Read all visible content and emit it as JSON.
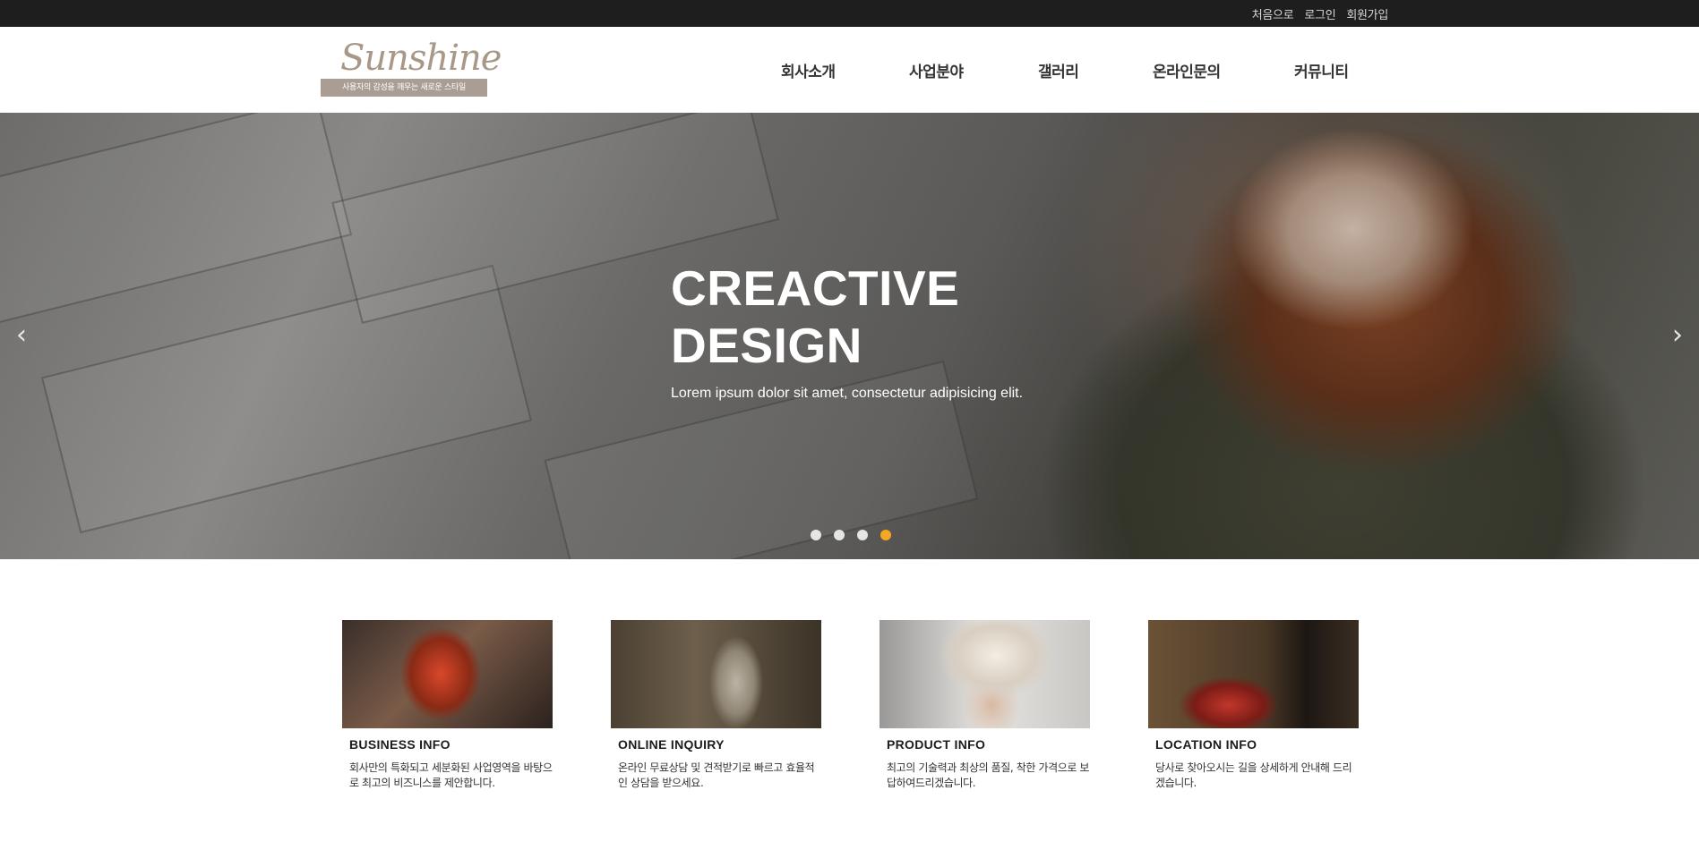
{
  "topbar": {
    "links": [
      "처음으로",
      "로그인",
      "회원가입"
    ]
  },
  "header": {
    "logo_text": "Sunshine",
    "logo_tagline": "사용자의 감성을 깨우는 새로운 스타일",
    "nav": [
      "회사소개",
      "사업분야",
      "갤러리",
      "온라인문의",
      "커뮤니티"
    ]
  },
  "hero": {
    "title_line1": "CREACTIVE",
    "title_line2": "DESIGN",
    "subtitle": "Lorem ipsum dolor sit amet, consectetur adipisicing elit.",
    "prev_icon": "chevron-left-icon",
    "next_icon": "chevron-right-icon",
    "slide_count": 4,
    "active_slide": 4,
    "active_dot_color": "#f5a623"
  },
  "cards": [
    {
      "title": "BUSINESS INFO",
      "desc": "회사만의 특화되고 세분화된 사업영역을 바탕으로 최고의 비즈니스를 제안합니다."
    },
    {
      "title": "ONLINE INQUIRY",
      "desc": "온라인 무료상담 및 견적받기로 빠르고 효율적인 상담을 받으세요."
    },
    {
      "title": "PRODUCT INFO",
      "desc": "최고의 기술력과 최상의 품질, 착한 가격으로 보답하여드리겠습니다."
    },
    {
      "title": "LOCATION INFO",
      "desc": "당사로 찾아오시는 길을 상세하게 안내해 드리겠습니다."
    }
  ]
}
